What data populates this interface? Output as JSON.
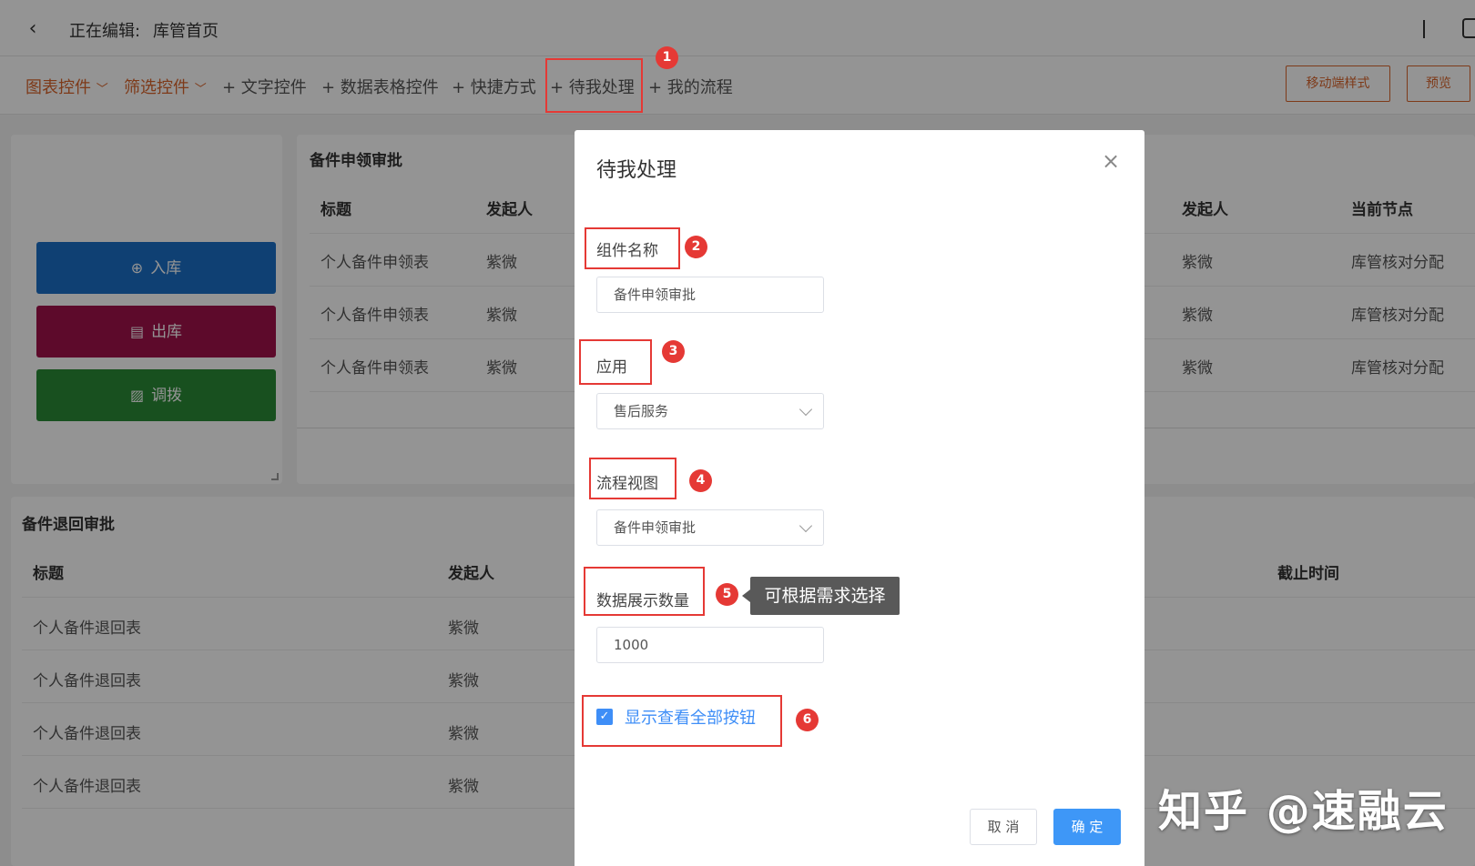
{
  "header": {
    "editing_label": "正在编辑:",
    "page_title": "库管首页"
  },
  "toolbar": {
    "chart_widgets": "图表控件",
    "filter_widgets": "筛选控件",
    "text_widget": "+ 文字控件",
    "table_widget": "+ 数据表格控件",
    "shortcut": "+ 快捷方式",
    "pending": "+ 待我处理",
    "my_process": "+ 我的流程",
    "mobile_style": "移动端样式",
    "preview": "预览",
    "accent_color": "#d9652c"
  },
  "actions": [
    {
      "label": "入库",
      "color": "#1b6fc6",
      "icon": "plus-circle-icon"
    },
    {
      "label": "出库",
      "color": "#a0124a",
      "icon": "calendar-icon"
    },
    {
      "label": "调拨",
      "color": "#2a8a36",
      "icon": "chart-icon"
    }
  ],
  "approval_table": {
    "title": "备件申领审批",
    "headers": {
      "title": "标题",
      "initiator": "发起人",
      "initiator2": "发起人",
      "node": "当前节点"
    },
    "rows": [
      {
        "title": "个人备件申领表",
        "initiator": "紫微",
        "initiator2": "紫微",
        "node": "库管核对分配"
      },
      {
        "title": "个人备件申领表",
        "initiator": "紫微",
        "initiator2": "紫微",
        "node": "库管核对分配"
      },
      {
        "title": "个人备件申领表",
        "initiator": "紫微",
        "initiator2": "紫微",
        "node": "库管核对分配"
      }
    ]
  },
  "return_table": {
    "title": "备件退回审批",
    "headers": {
      "title": "标题",
      "initiator": "发起人",
      "deadline": "截止时间"
    },
    "rows": [
      {
        "title": "个人备件退回表",
        "initiator": "紫微"
      },
      {
        "title": "个人备件退回表",
        "initiator": "紫微"
      },
      {
        "title": "个人备件退回表",
        "initiator": "紫微"
      },
      {
        "title": "个人备件退回表",
        "initiator": "紫微"
      }
    ]
  },
  "modal": {
    "title": "待我处理",
    "name_label": "组件名称",
    "name_value": "备件申领审批",
    "app_label": "应用",
    "app_value": "售后服务",
    "view_label": "流程视图",
    "view_value": "备件申领审批",
    "count_label": "数据展示数量",
    "count_value": "1000",
    "show_all_label": "显示查看全部按钮",
    "show_all_checked": true,
    "cancel": "取 消",
    "confirm": "确 定",
    "primary_color": "#3e97f7"
  },
  "annotations": {
    "badges": [
      "1",
      "2",
      "3",
      "4",
      "5",
      "6"
    ],
    "tooltip": "可根据需求选择",
    "color": "#e53935"
  },
  "watermark": "知乎 @速融云"
}
